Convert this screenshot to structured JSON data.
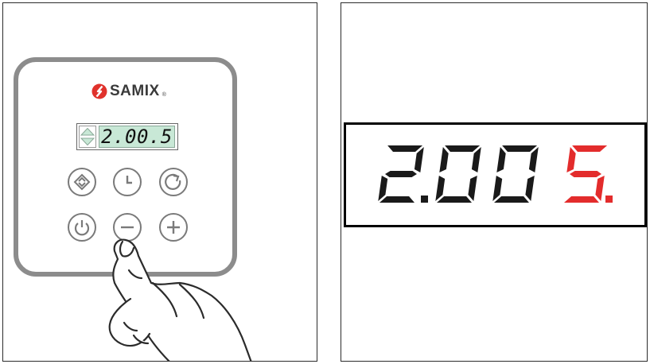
{
  "brand": {
    "name": "SAMIX",
    "registered_mark": "®",
    "icon": "samix-logo-icon"
  },
  "controller": {
    "lcd_reading": "2.00.5",
    "lcd_arrows_icon": "up-down-arrows-icon",
    "buttons": [
      {
        "name": "mode-button",
        "icon": "up-down-chevron-icon"
      },
      {
        "name": "clock-button",
        "icon": "clock-icon"
      },
      {
        "name": "refresh-button",
        "icon": "circular-arrow-icon"
      },
      {
        "name": "power-button",
        "icon": "power-icon"
      },
      {
        "name": "minus-button",
        "icon": "minus-icon"
      },
      {
        "name": "plus-button",
        "icon": "plus-icon"
      }
    ],
    "pressed_button": "minus-button",
    "hand_icon": "pointing-hand-icon"
  },
  "zoomed_display": {
    "digits": [
      "2",
      "0",
      "0",
      "5"
    ],
    "decimal_after": [
      0,
      3
    ],
    "highlighted_digit_index": 3,
    "digit_color": "#1a1a1a",
    "highlight_color": "#e32c2c"
  },
  "colors": {
    "brand_red": "#e0322c",
    "lcd_green": "#c8e8d6",
    "panel_border": "#8c8c8c"
  }
}
